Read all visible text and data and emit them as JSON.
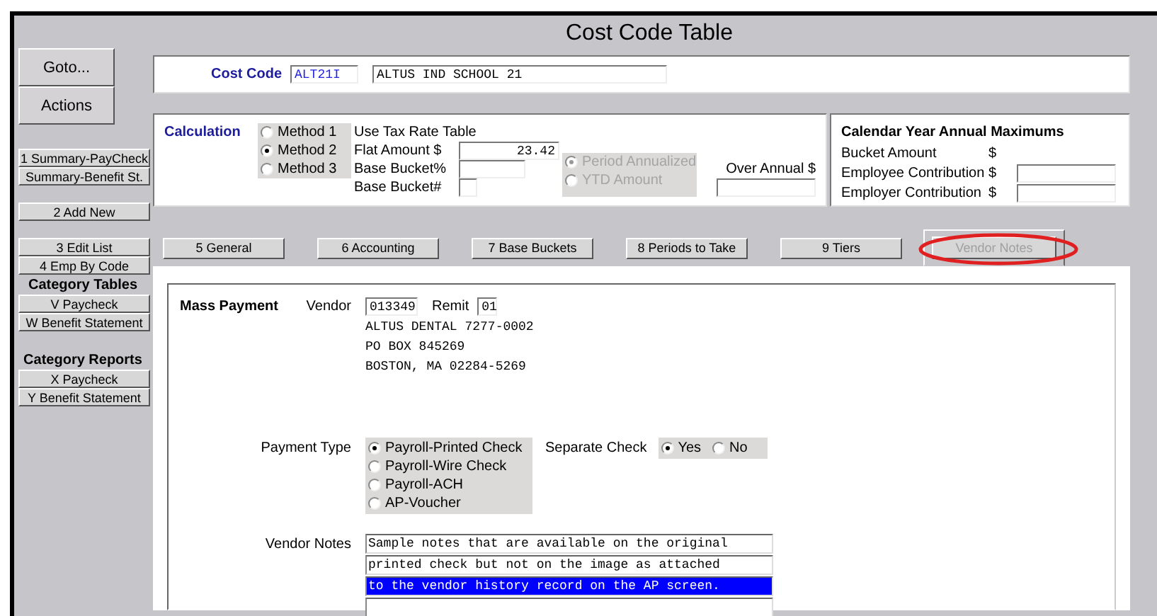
{
  "window": {
    "title": "Cost Code Table"
  },
  "sidebar": {
    "top_buttons": [
      "Goto...",
      "Actions"
    ],
    "groups": [
      {
        "buttons": [
          "1 Summary-PayCheck",
          "Summary-Benefit St."
        ]
      },
      {
        "buttons": [
          "2 Add New"
        ]
      },
      {
        "buttons": [
          "3 Edit List",
          "4 Emp By Code"
        ]
      },
      {
        "heading": "Category Tables",
        "buttons": [
          "V Paycheck",
          "W Benefit Statement"
        ]
      },
      {
        "heading": "Category Reports",
        "buttons": [
          "X Paycheck",
          "Y Benefit Statement"
        ]
      }
    ]
  },
  "cost_code": {
    "label": "Cost Code",
    "code": "ALT21I",
    "description": "ALTUS IND SCHOOL 21"
  },
  "calculation": {
    "title": "Calculation",
    "methods": [
      {
        "label": "Method 1",
        "selected": false
      },
      {
        "label": "Method 2",
        "selected": true
      },
      {
        "label": "Method 3",
        "selected": false
      }
    ],
    "fields": [
      {
        "label": "Use Tax Rate Table",
        "kind": "text"
      },
      {
        "label": "Flat Amount $",
        "kind": "input",
        "value": "23.42"
      },
      {
        "label": "Base Bucket%",
        "kind": "input"
      },
      {
        "label": "Base Bucket#",
        "kind": "small-input"
      }
    ],
    "period_options": [
      {
        "label": "Period Annualized",
        "selected": true,
        "disabled": true
      },
      {
        "label": "YTD Amount",
        "selected": false,
        "disabled": true
      }
    ],
    "over_annual": {
      "label": "Over Annual $"
    }
  },
  "annual_maximums": {
    "title": "Calendar Year Annual Maximums",
    "rows": [
      {
        "label": "Bucket Amount",
        "currency": "$",
        "kind": "text"
      },
      {
        "label": "Employee Contribution",
        "currency": "$",
        "kind": "input"
      },
      {
        "label": "Employer Contribution",
        "currency": "$",
        "kind": "input"
      }
    ]
  },
  "tabs": [
    {
      "label": "5 General",
      "selected": false,
      "disabled": false,
      "highlighted": false
    },
    {
      "label": "6 Accounting",
      "selected": false,
      "disabled": false,
      "highlighted": false
    },
    {
      "label": "7 Base Buckets",
      "selected": false,
      "disabled": false,
      "highlighted": false
    },
    {
      "label": "8 Periods to Take",
      "selected": false,
      "disabled": false,
      "highlighted": false
    },
    {
      "label": "9 Tiers",
      "selected": false,
      "disabled": false,
      "highlighted": false
    },
    {
      "label": "Vendor Notes",
      "selected": true,
      "disabled": true,
      "highlighted": true
    }
  ],
  "mass_payment": {
    "title": "Mass Payment",
    "vendor_label": "Vendor",
    "vendor": "013349",
    "remit_label": "Remit",
    "remit": "01",
    "address": [
      "ALTUS DENTAL 7277-0002",
      "PO BOX 845269",
      "BOSTON, MA 02284-5269"
    ],
    "payment_type": {
      "label": "Payment Type",
      "options": [
        {
          "label": "Payroll-Printed Check",
          "selected": true
        },
        {
          "label": "Payroll-Wire Check",
          "selected": false
        },
        {
          "label": "Payroll-ACH",
          "selected": false
        },
        {
          "label": "AP-Voucher",
          "selected": false
        }
      ]
    },
    "separate_check": {
      "label": "Separate Check",
      "options": [
        {
          "label": "Yes",
          "selected": true
        },
        {
          "label": "No",
          "selected": false
        }
      ]
    },
    "vendor_notes": {
      "label": "Vendor Notes",
      "lines": [
        {
          "text": "Sample notes that are available on the original",
          "selected": false
        },
        {
          "text": "printed check but not on the image as attached",
          "selected": false
        },
        {
          "text": "to the vendor history record on the AP screen.",
          "selected": true
        },
        {
          "selected": false
        }
      ]
    }
  }
}
